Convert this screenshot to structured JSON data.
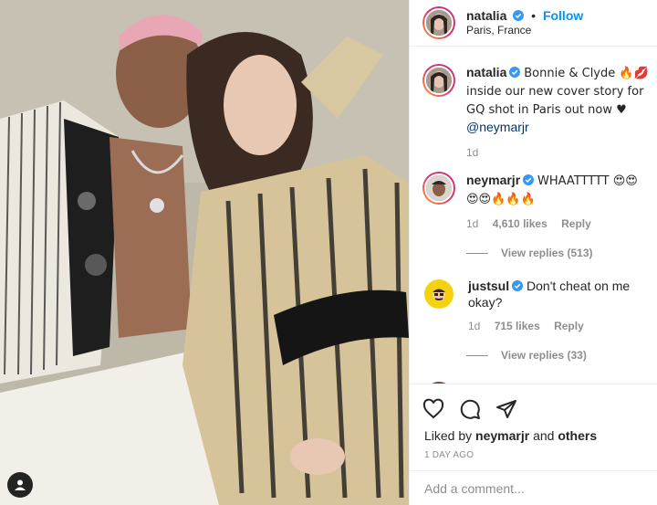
{
  "header": {
    "username": "natalia",
    "dot": "•",
    "follow_label": "Follow",
    "location": "Paris, France"
  },
  "caption": {
    "username": "natalia",
    "text": "Bonnie & Clyde 🔥💋 inside our new cover story for GQ shot in Paris out now ♥",
    "mention": "@neymarjr",
    "time": "1d"
  },
  "comments": [
    {
      "username": "neymarjr",
      "text": "WHAATTTTT 😍😍 😍😍🔥🔥🔥",
      "time": "1d",
      "likes": "4,610 likes",
      "reply_label": "Reply",
      "view_replies": "View replies (513)"
    },
    {
      "username": "justsul",
      "text": "Don't cheat on me okay?",
      "time": "1d",
      "likes": "715 likes",
      "reply_label": "Reply",
      "view_replies": "View replies (33)"
    }
  ],
  "actions": {
    "liked_prefix": "Liked by",
    "liked_user": "neymarjr",
    "liked_and": "and",
    "liked_others": "others",
    "timestamp": "1 DAY AGO"
  },
  "add_comment": {
    "placeholder": "Add a comment..."
  },
  "icons": {
    "like": "heart-icon",
    "comment": "comment-icon",
    "share": "share-icon",
    "verified": "verified-badge-icon",
    "tag": "user-tag-icon"
  },
  "colors": {
    "link_blue": "#0095f6",
    "verified_blue": "#3897f0",
    "muted": "#8e8e8e",
    "text": "#262626"
  }
}
